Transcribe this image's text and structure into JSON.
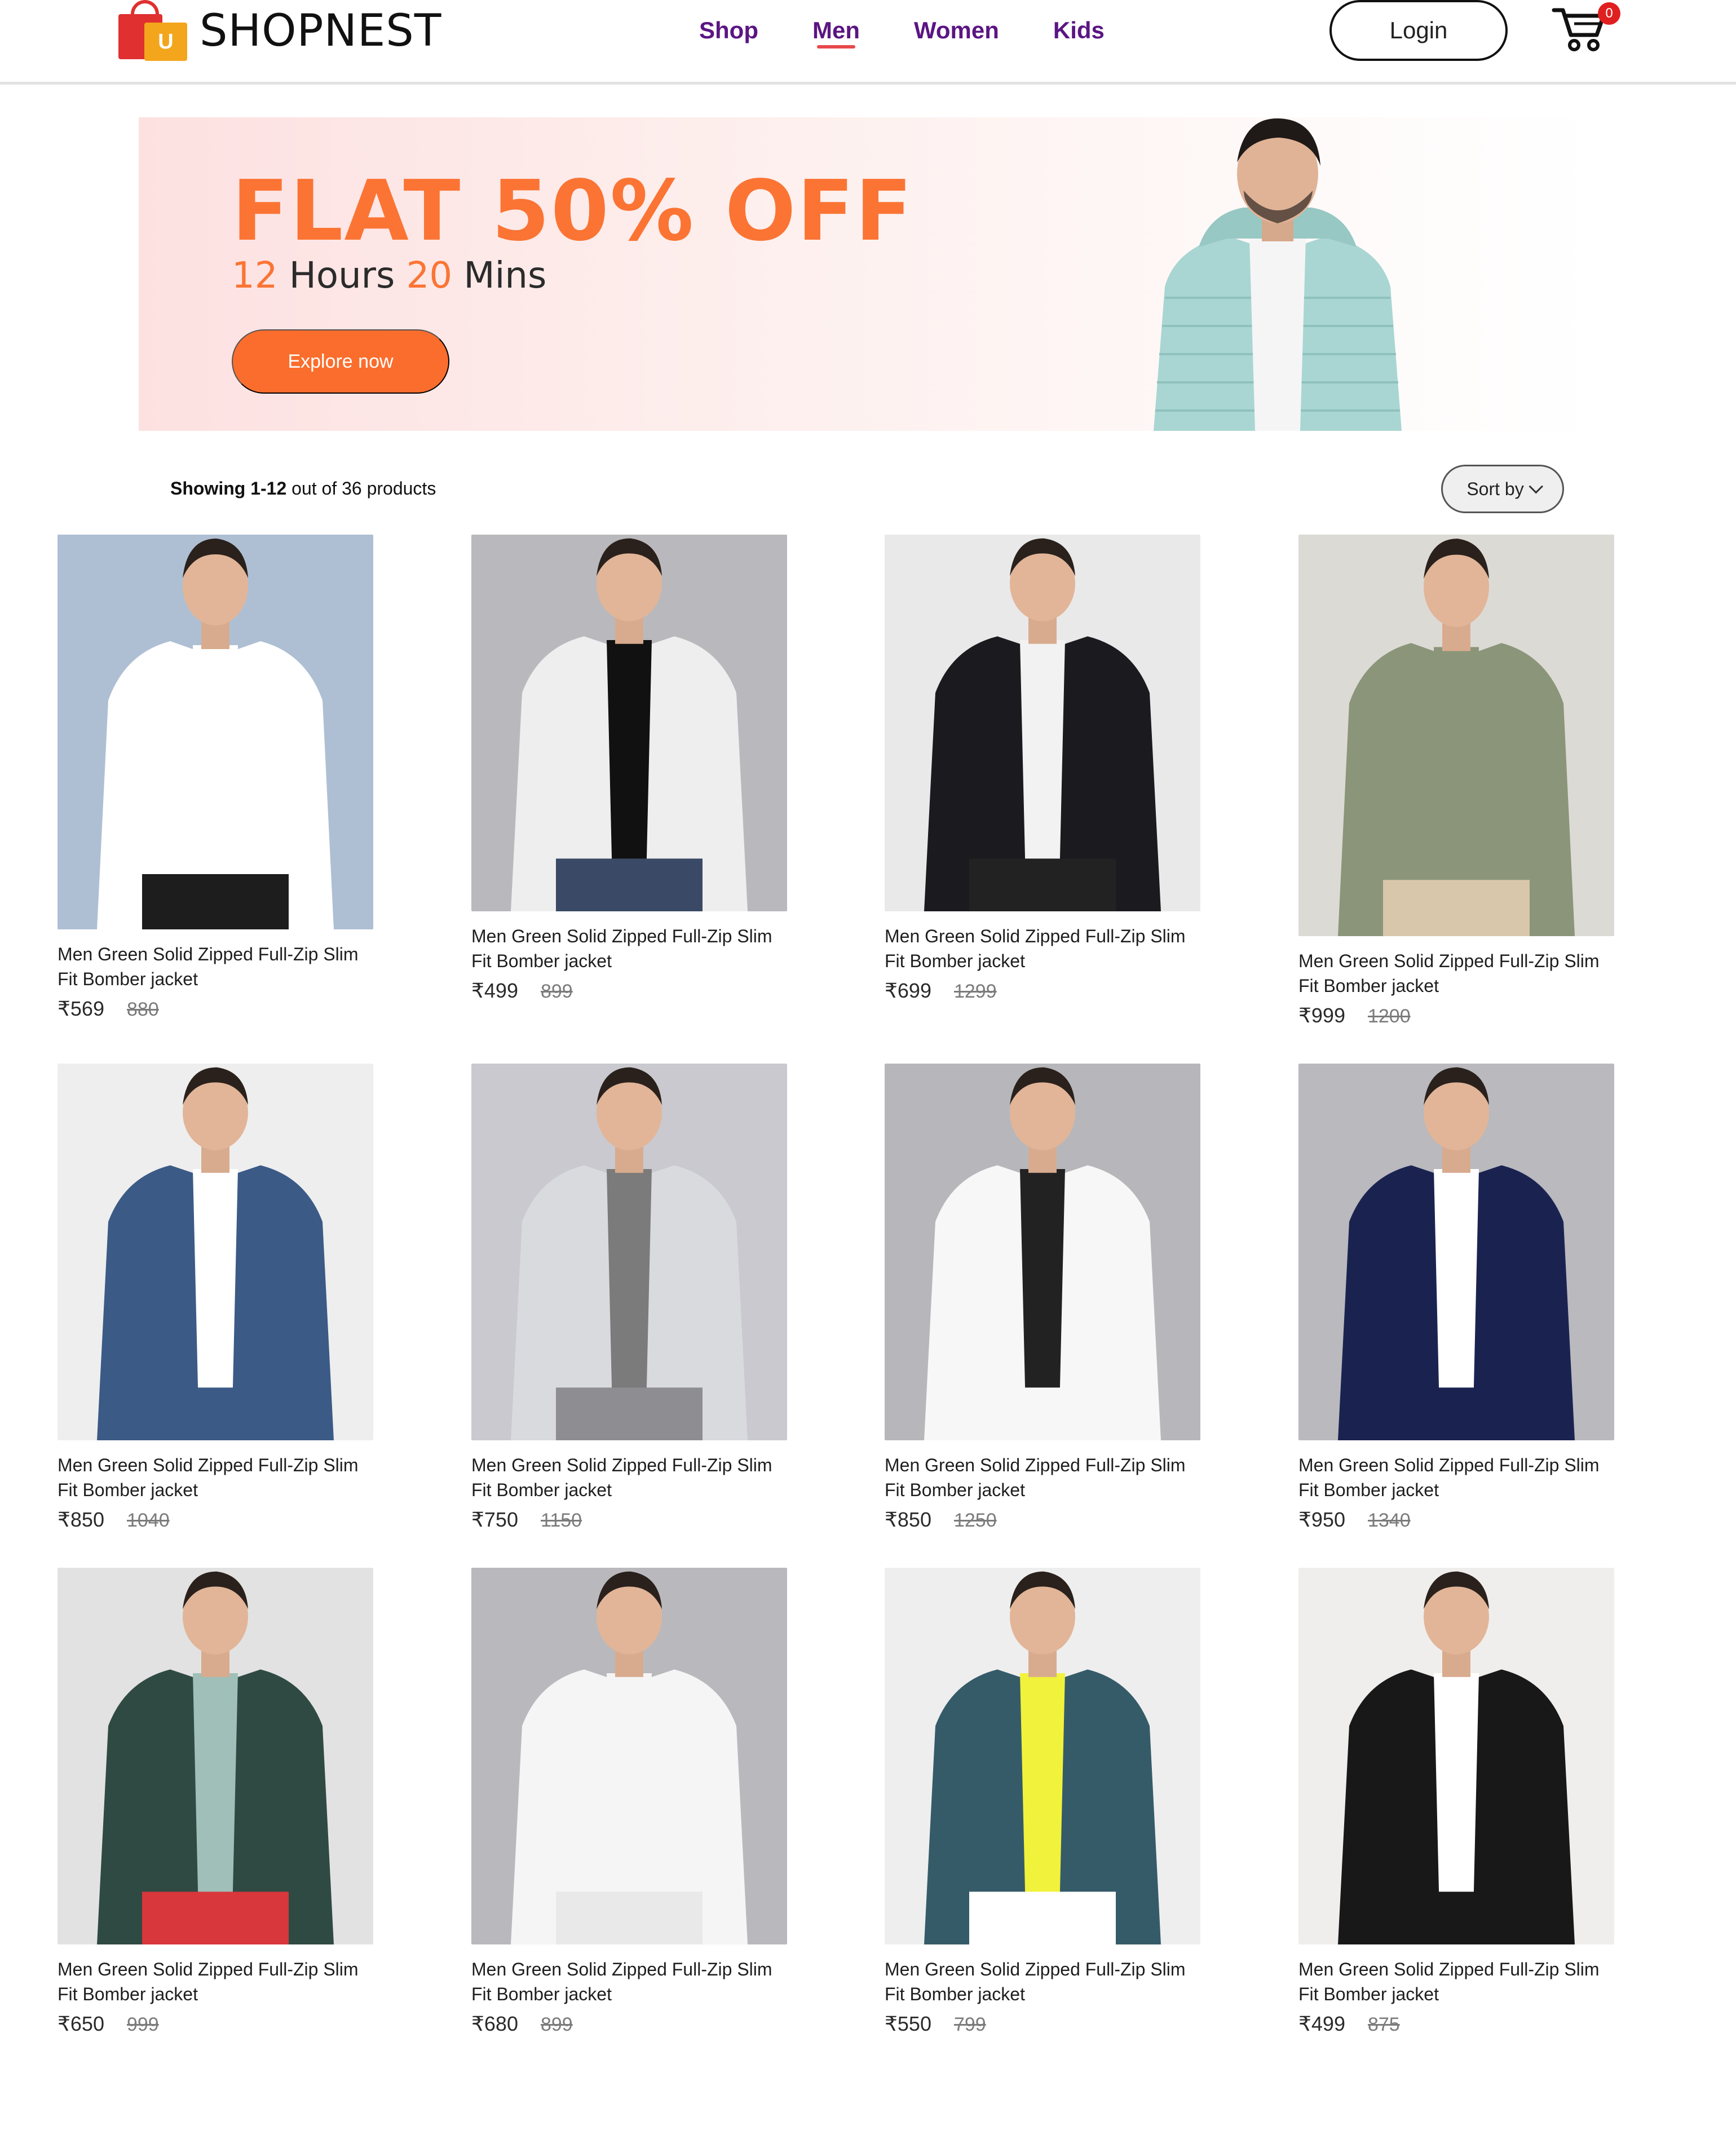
{
  "brand": {
    "name": "SHOPNEST",
    "logo_letter": "U"
  },
  "nav": {
    "items": [
      "Shop",
      "Men",
      "Women",
      "Kids"
    ],
    "active": "Men"
  },
  "header": {
    "login_label": "Login",
    "cart_count": "0"
  },
  "banner": {
    "title": "FLAT 50% OFF",
    "timer_hours": "12",
    "timer_hours_label": "Hours",
    "timer_mins": "20",
    "timer_mins_label": "Mins",
    "cta_label": "Explore now",
    "bg_color": "#fde1e1",
    "accent": "#fb7434"
  },
  "listing": {
    "showing_range": "Showing 1-12",
    "showing_total": "out of 36 products",
    "sort_label": "Sort by"
  },
  "products": [
    {
      "name": "Men Green Solid Zipped Full-Zip Slim Fit Bomber jacket",
      "price": "₹569",
      "mrp": "880"
    },
    {
      "name": "Men Green Solid Zipped Full-Zip Slim Fit Bomber jacket",
      "price": "₹499",
      "mrp": "899"
    },
    {
      "name": "Men Green Solid Zipped Full-Zip Slim Fit Bomber jacket",
      "price": "₹699",
      "mrp": "1299"
    },
    {
      "name": "Men Green Solid Zipped Full-Zip Slim Fit Bomber jacket",
      "price": "₹999",
      "mrp": "1200"
    },
    {
      "name": "Men Green Solid Zipped Full-Zip Slim Fit Bomber jacket",
      "price": "₹850",
      "mrp": "1040"
    },
    {
      "name": "Men Green Solid Zipped Full-Zip Slim Fit Bomber jacket",
      "price": "₹750",
      "mrp": "1150"
    },
    {
      "name": "Men Green Solid Zipped Full-Zip Slim Fit Bomber jacket",
      "price": "₹850",
      "mrp": "1250"
    },
    {
      "name": "Men Green Solid Zipped Full-Zip Slim Fit Bomber jacket",
      "price": "₹950",
      "mrp": "1340"
    },
    {
      "name": "Men Green Solid Zipped Full-Zip Slim Fit Bomber jacket",
      "price": "₹650",
      "mrp": "999"
    },
    {
      "name": "Men Green Solid Zipped Full-Zip Slim Fit Bomber jacket",
      "price": "₹680",
      "mrp": "899"
    },
    {
      "name": "Men Green Solid Zipped Full-Zip Slim Fit Bomber jacket",
      "price": "₹550",
      "mrp": "799"
    },
    {
      "name": "Men Green Solid Zipped Full-Zip Slim Fit Bomber jacket",
      "price": "₹499",
      "mrp": "875"
    }
  ],
  "product_visuals": [
    {
      "bg": "#aebfd3",
      "garment": "#ffffff",
      "inner": "#ffffff",
      "pants": "#1d1d1d"
    },
    {
      "bg": "#b9b9bd",
      "garment": "#eeeeee",
      "inner": "#111111",
      "pants": "#3a4a66"
    },
    {
      "bg": "#e9e9ea",
      "garment": "#1b1b1f",
      "inner": "#f2f2f2",
      "pants": "#222222"
    },
    {
      "bg": "#dcdad5",
      "garment": "#8b9579",
      "inner": "#8b9579",
      "pants": "#d8c7ab"
    },
    {
      "bg": "#eeeeee",
      "garment": "#3b5a86",
      "inner": "#ffffff",
      "pants": "#3b5a86"
    },
    {
      "bg": "#c9c9cf",
      "garment": "#d9dade",
      "inner": "#7b7b7b",
      "pants": "#8d8d92"
    },
    {
      "bg": "#b7b7bb",
      "garment": "#f7f7f7",
      "inner": "#222222",
      "pants": "#f7f7f7"
    },
    {
      "bg": "#b9b9be",
      "garment": "#1a2350",
      "inner": "#ffffff",
      "pants": "#1a2350"
    },
    {
      "bg": "#e2e2e2",
      "garment": "#2f4a42",
      "inner": "#9fbfb8",
      "pants": "#d8373c"
    },
    {
      "bg": "#b9b9bd",
      "garment": "#f5f5f5",
      "inner": "#f5f5f5",
      "pants": "#e9e9e9"
    },
    {
      "bg": "#eeeeee",
      "garment": "#355b69",
      "inner": "#f1f23b",
      "pants": "#ffffff"
    },
    {
      "bg": "#f0eeec",
      "garment": "#181818",
      "inner": "#ffffff",
      "pants": "#181818"
    }
  ]
}
